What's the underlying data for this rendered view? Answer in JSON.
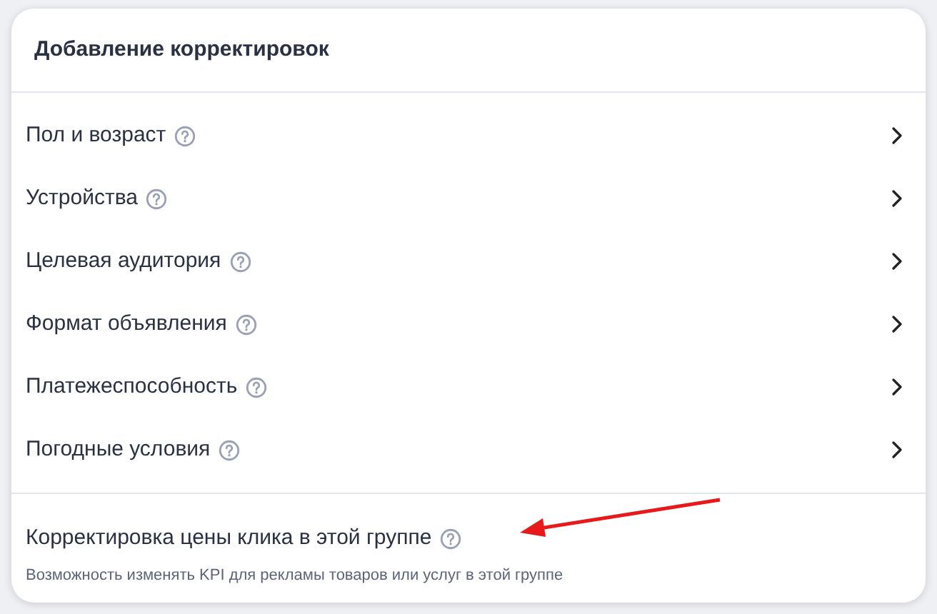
{
  "dialog": {
    "title": "Добавление корректировок",
    "items": [
      {
        "label": "Пол и возраст"
      },
      {
        "label": "Устройства"
      },
      {
        "label": "Целевая аудитория"
      },
      {
        "label": "Формат объявления"
      },
      {
        "label": "Платежеспособность"
      },
      {
        "label": "Погодные условия"
      }
    ],
    "footer": {
      "title": "Корректировка цены клика в этой группе",
      "description": "Возможность изменять KPI для рекламы товаров или услуг в этой группе"
    }
  }
}
